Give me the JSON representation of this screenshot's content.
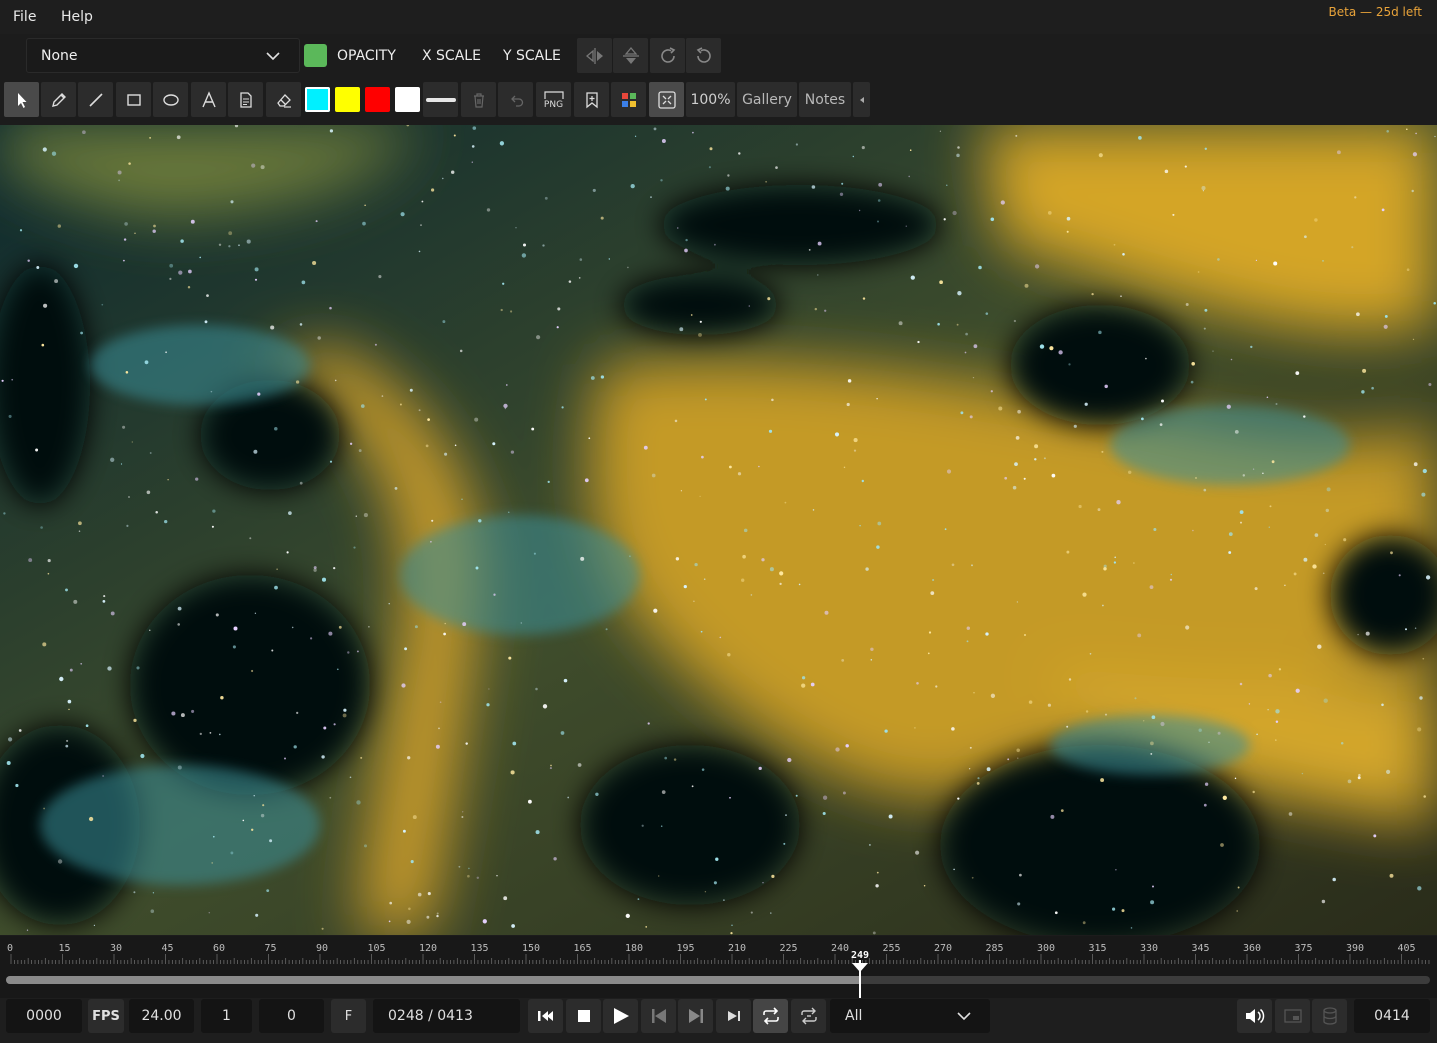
{
  "menubar": {
    "file": "File",
    "help": "Help",
    "beta_notice": "Beta — 25d left"
  },
  "toolbar1": {
    "dropdown_value": "None",
    "swatch_color": "#5bb85a",
    "opacity_label": "OPACITY",
    "xscale_label": "X SCALE",
    "yscale_label": "Y SCALE",
    "buttons": [
      "flip-horizontal-icon",
      "flip-vertical-icon",
      "rotate-cw-icon",
      "rotate-ccw-icon"
    ]
  },
  "toolbar2": {
    "tools": [
      "pointer-icon",
      "pencil-icon",
      "line-icon",
      "rectangle-icon",
      "ellipse-icon",
      "text-icon",
      "note-icon",
      "eraser-icon"
    ],
    "colors": [
      "#00f0ff",
      "#ffff00",
      "#ff0000",
      "#ffffff"
    ],
    "selected_color": "#00f0ff",
    "png_label": "PNG",
    "zoom_label": "100%",
    "gallery_label": "Gallery",
    "notes_label": "Notes"
  },
  "timeline": {
    "ticks": [
      "0",
      "15",
      "30",
      "45",
      "60",
      "75",
      "90",
      "105",
      "120",
      "135",
      "150",
      "165",
      "180",
      "195",
      "210",
      "225",
      "240",
      "255",
      "270",
      "285",
      "300",
      "315",
      "330",
      "345",
      "360",
      "375",
      "390",
      "405"
    ],
    "playhead_label": "249",
    "progress": 0.6
  },
  "bottombar": {
    "start_frame": "0000",
    "fps_label": "FPS",
    "fps_value": "24.00",
    "field1": "1",
    "field2": "0",
    "f_label": "F",
    "frame_counter": "0248 / 0413",
    "range_select": "All",
    "end_frame": "0414"
  }
}
